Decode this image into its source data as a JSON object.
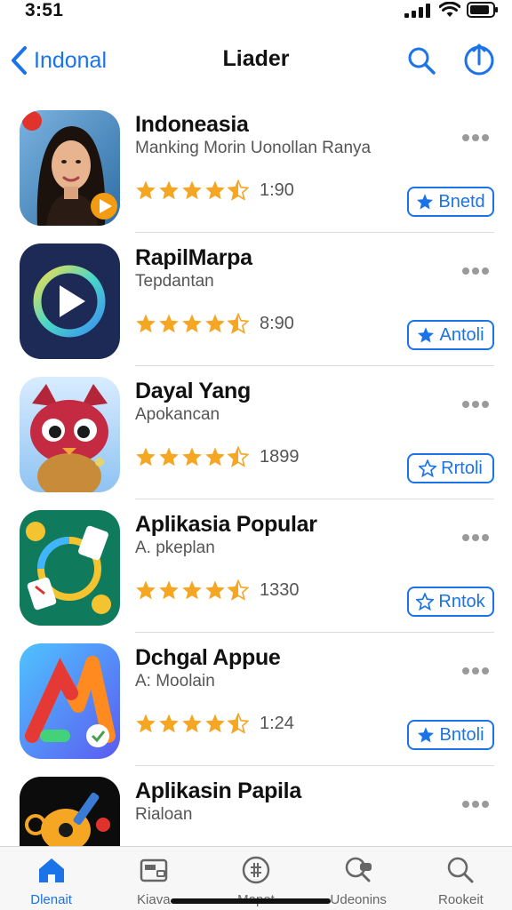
{
  "status_bar": {
    "time": "3:51",
    "icons": [
      "signal-icon",
      "wifi-icon",
      "battery-icon"
    ]
  },
  "nav": {
    "back_label": "Indonal",
    "title": "Liader",
    "icons": [
      "chevron-left-icon",
      "search-icon",
      "share-icon"
    ]
  },
  "colors": {
    "accent": "#1a73e8",
    "star": "#f5a623",
    "divider": "#dcdcdc"
  },
  "apps": [
    {
      "name": "Indoneasia",
      "subtitle": "Manking Morin Uonollan Ranya",
      "rating_value": "1:90",
      "stars": 4.5,
      "button_label": "Bnetd",
      "button_icon": "star-filled-icon",
      "icon": "portrait-app-icon"
    },
    {
      "name": "RapilMarpa",
      "subtitle": "Tepdantan",
      "rating_value": "8:90",
      "stars": 4.5,
      "button_label": "Antoli",
      "button_icon": "star-filled-icon",
      "icon": "play-app-icon"
    },
    {
      "name": "Dayal Yang",
      "subtitle": "Apokancan",
      "rating_value": "1899",
      "stars": 4.5,
      "button_label": "Rrtoli",
      "button_icon": "star-outline-icon",
      "icon": "cat-app-icon"
    },
    {
      "name": "Aplikasia Popular",
      "subtitle": "A. pkeplan",
      "rating_value": "1330",
      "stars": 4.5,
      "button_label": "Rntok",
      "button_icon": "star-outline-icon",
      "icon": "cards-app-icon"
    },
    {
      "name": "Dchgal Appue",
      "subtitle": "A: Moolain",
      "rating_value": "1:24",
      "stars": 4.5,
      "button_label": "Bntoli",
      "button_icon": "star-filled-icon",
      "icon": "maps-app-icon"
    },
    {
      "name": "Aplikasin Papila",
      "subtitle": "Rialoan",
      "icon": "guitar-app-icon"
    }
  ],
  "tabs": [
    {
      "label": "Dlenait",
      "icon": "home-icon",
      "active": true
    },
    {
      "label": "Kiava",
      "icon": "wallet-icon",
      "active": false
    },
    {
      "label": "Mapot",
      "icon": "compass-icon",
      "active": false
    },
    {
      "label": "Udeonins",
      "icon": "chat-search-icon",
      "active": false
    },
    {
      "label": "Rookeit",
      "icon": "search-icon",
      "active": false
    }
  ]
}
